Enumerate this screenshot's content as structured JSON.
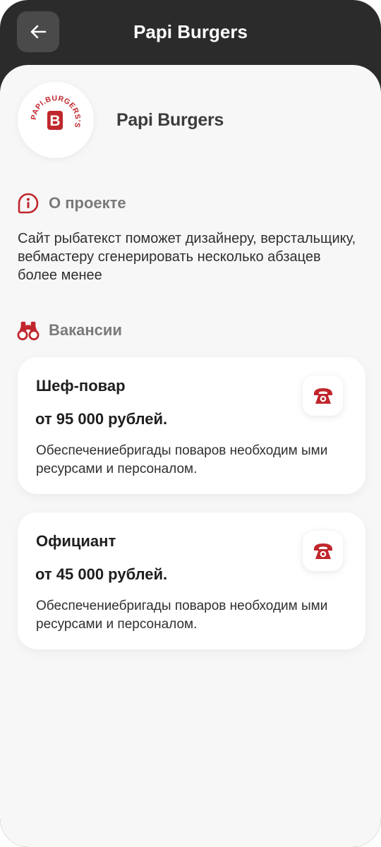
{
  "header": {
    "title": "Papi Burgers",
    "back_icon": "arrow-left-icon"
  },
  "brand": {
    "name": "Papi Burgers",
    "logo_text": "PAPI.BURGERS'S",
    "logo_letter": "B",
    "accent_color": "#c0272d"
  },
  "about": {
    "heading": "О проекте",
    "icon": "info-badge-icon",
    "text": "Сайт рыбатекст поможет дизайнеру, верстальщику, вебмастеру сгенерировать несколько абзацев более менее"
  },
  "vacancies": {
    "heading": "Вакансии",
    "icon": "binoculars-icon",
    "items": [
      {
        "title": "Шеф-повар",
        "salary": "от 95 000 рублей.",
        "description": "Обеспечениебригады поваров необходим ыми ресурсами и персоналом.",
        "action_icon": "phone-icon"
      },
      {
        "title": "Официант",
        "salary": "от 45 000 рублей.",
        "description": "Обеспечениебригады поваров необходим ыми ресурсами и персоналом.",
        "action_icon": "phone-icon"
      }
    ]
  }
}
